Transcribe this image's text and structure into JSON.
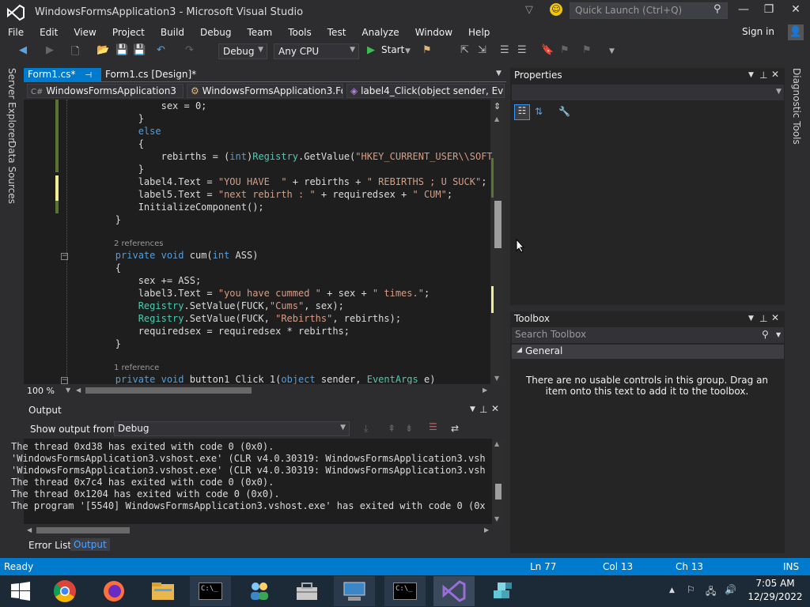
{
  "window": {
    "title": "WindowsFormsApplication3 - Microsoft Visual Studio",
    "quick_launch_placeholder": "Quick Launch (Ctrl+Q)"
  },
  "menu": [
    "File",
    "Edit",
    "View",
    "Project",
    "Build",
    "Debug",
    "Team",
    "Tools",
    "Test",
    "Analyze",
    "Window",
    "Help"
  ],
  "signin": "Sign in",
  "toolbar": {
    "config": "Debug",
    "platform": "Any CPU",
    "start": "Start"
  },
  "left_strip": [
    "Server Explorer",
    "Data Sources"
  ],
  "right_strip": "Diagnostic Tools",
  "editor": {
    "tabs": [
      {
        "label": "Form1.cs*",
        "active": true
      },
      {
        "label": "Form1.cs [Design]*",
        "active": false
      }
    ],
    "nav": {
      "project": "WindowsFormsApplication3",
      "class": "WindowsFormsApplication3.Fo",
      "member": "label4_Click(object sender, Eve"
    },
    "code_lines": [
      "                sex = 0;",
      "            }",
      "            else",
      "            {",
      "                rebirths = (int)Registry.GetValue(\"HKEY_CURRENT_USER\\\\SOFTWA",
      "            }",
      "            label4.Text = \"YOU HAVE  \" + rebirths + \" REBIRTHS ; U SUCK\";",
      "            label5.Text = \"next rebirth : \" + requiredsex + \" CUM\";",
      "            InitializeComponent();",
      "        }",
      "",
      "        private void cum(int ASS)",
      "        {",
      "            sex += ASS;",
      "            label3.Text = \"you have cummed \" + sex + \" times.\";",
      "            Registry.SetValue(FUCK,\"Cums\", sex);",
      "            Registry.SetValue(FUCK, \"Rebirths\", rebirths);",
      "            requiredsex = requiredsex * rebirths;",
      "        }",
      "",
      "        private void button1_Click_1(object sender, EventArgs e)"
    ],
    "refs_1": "2 references",
    "refs_2": "1 reference",
    "zoom": "100 %"
  },
  "output": {
    "title": "Output",
    "show_from_label": "Show output from:",
    "show_from_value": "Debug",
    "lines": [
      "The thread 0xd38 has exited with code 0 (0x0).",
      "'WindowsFormsApplication3.vshost.exe' (CLR v4.0.30319: WindowsFormsApplication3.vsh",
      "'WindowsFormsApplication3.vshost.exe' (CLR v4.0.30319: WindowsFormsApplication3.vsh",
      "The thread 0x7c4 has exited with code 0 (0x0).",
      "The thread 0x1204 has exited with code 0 (0x0).",
      "The program '[5540] WindowsFormsApplication3.vshost.exe' has exited with code 0 (0x"
    ]
  },
  "bottom_tabs": [
    "Error List",
    "Output"
  ],
  "properties": {
    "title": "Properties"
  },
  "toolbox": {
    "title": "Toolbox",
    "search_placeholder": "Search Toolbox",
    "group": "General",
    "empty_text": "There are no usable controls in this group. Drag an item onto this text to add it to the toolbox."
  },
  "status": {
    "state": "Ready",
    "ln": "Ln 77",
    "col": "Col 13",
    "ch": "Ch 13",
    "mode": "INS"
  },
  "taskbar": {
    "time": "7:05 AM",
    "date": "12/29/2022",
    "apps": [
      "windows-start",
      "chrome",
      "firefox",
      "file-explorer",
      "cmd",
      "network-app",
      "toolbox-app",
      "remote-desktop",
      "cmd-2",
      "visual-studio",
      "blocks-app"
    ]
  },
  "colors": {
    "accent": "#007acc",
    "keyword": "#569cd6",
    "string": "#d69d85",
    "type": "#4ec9b0"
  }
}
